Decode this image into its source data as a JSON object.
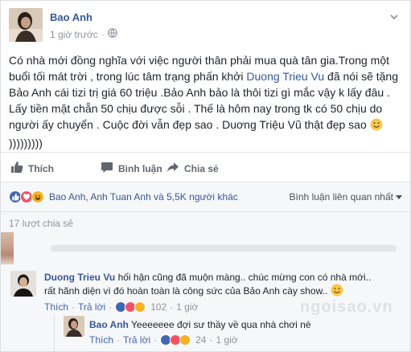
{
  "colors": {
    "link": "#365899",
    "muted": "#90949c",
    "like": "#4267b2",
    "love": "#f25268",
    "haha": "#f7b125",
    "bg_alt": "#f6f7f9"
  },
  "post": {
    "author": "Bao Anh",
    "time": "1 giờ trước",
    "privacy_icon": "globe-icon",
    "menu_icon": "chevron-down-icon",
    "text": {
      "line1": "Có nhà mới đồng nghĩa với việc người thân phải mua quà tân gia.Trong một",
      "line2": "buổi tối mát trời , trong lúc tâm trạng phấn khởi",
      "mention": "Duong Trieu Vu",
      "line2_end": "đã nói sẽ tặng",
      "line3": "Bảo Anh cái tizi trị giá 60 triệu .Bảo Anh bảo là thôi tizi gì mắc vậy k lấy đâu .",
      "line4": "Lấy tiền mặt chẵn 50 chịu được sỗi . Thế là hôm nay trong tk có 50 chịu do",
      "line5": "người ấy chuyển . Cuộc đời vẫn đẹp sao . Duơng Triệu Vũ thật đẹp sao",
      "line6": ")))))))))"
    }
  },
  "actions": {
    "like": "Thích",
    "comment": "Bình luận",
    "share": "Chia sẻ"
  },
  "reactions": {
    "icons": [
      "like-icon",
      "love-icon",
      "haha-icon"
    ],
    "names": "Bao Anh, Anh Tuan Anh và 5,5K người khác",
    "sort_label": "Bình luận liên quan nhất"
  },
  "shares": "17 lượt chia sẻ",
  "comments": [
    {
      "author": "Duong Trieu Vu",
      "text": "hối hận cũng đã muộn màng.. chúc mừng con có nhà mới.. rất hãnh diện vì đó hoàn toàn là công sức của Bảo Anh cày show..",
      "like": "Thích",
      "reply": "Trả lời",
      "reaction_count": "102",
      "time": "1 giờ"
    },
    {
      "author": "Bao Anh",
      "text": "Yeeeeeee đợi sư thầy về qua nhà chơi nè",
      "like": "Thích",
      "reply": "Trả lời",
      "reaction_count": "24",
      "time": "1 giờ"
    }
  ],
  "watermark": "ngoisao.vn"
}
